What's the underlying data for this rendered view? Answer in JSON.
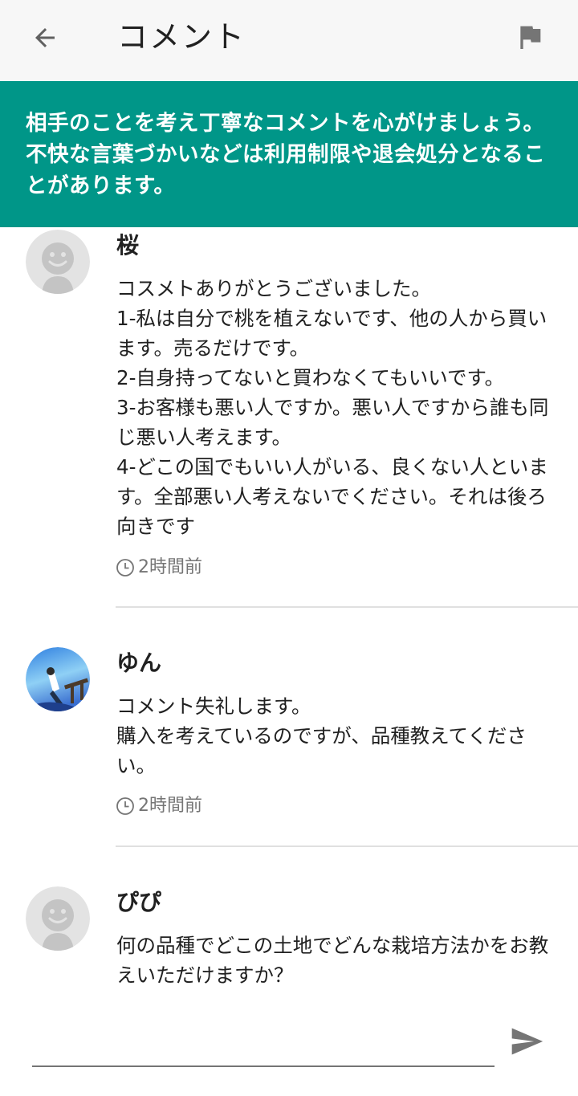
{
  "header": {
    "title": "コメント",
    "back_icon": "arrow-back-icon",
    "report_icon": "flag-icon"
  },
  "notice": {
    "text": "相手のことを考え丁寧なコメントを心がけましょう。不快な言葉づかいなどは利用制限や退会処分となることがあります。"
  },
  "comments": [
    {
      "user": "桜",
      "avatar": "default-avatar-icon",
      "body": "コスメトありがとうございました。\n1-私は自分で桃を植えないです、他の人から買います。売るだけです。\n2-自身持ってないと買わなくてもいいです。\n3-お客様も悪い人ですか。悪い人ですから誰も同じ悪い人考えます。\n4-どこの国でもいい人がいる、良くない人といます。全部悪い人考えないでください。それは後ろ向きです",
      "time": "2時間前"
    },
    {
      "user": "ゆん",
      "avatar": "photo-avatar",
      "body": "コメント失礼します。\n購入を考えているのですが、品種教えてください。",
      "time": "2時間前"
    },
    {
      "user": "ぴぴ",
      "avatar": "default-avatar-icon",
      "body": "何の品種でどこの土地でどんな栽培方法かをお教えいただけますか？",
      "time": ""
    }
  ],
  "composer": {
    "placeholder": "",
    "send_icon": "send-icon"
  },
  "colors": {
    "accent": "#009688",
    "appbar": "#f7f7f7",
    "divider": "#e0e0e0",
    "muted": "#757575"
  }
}
